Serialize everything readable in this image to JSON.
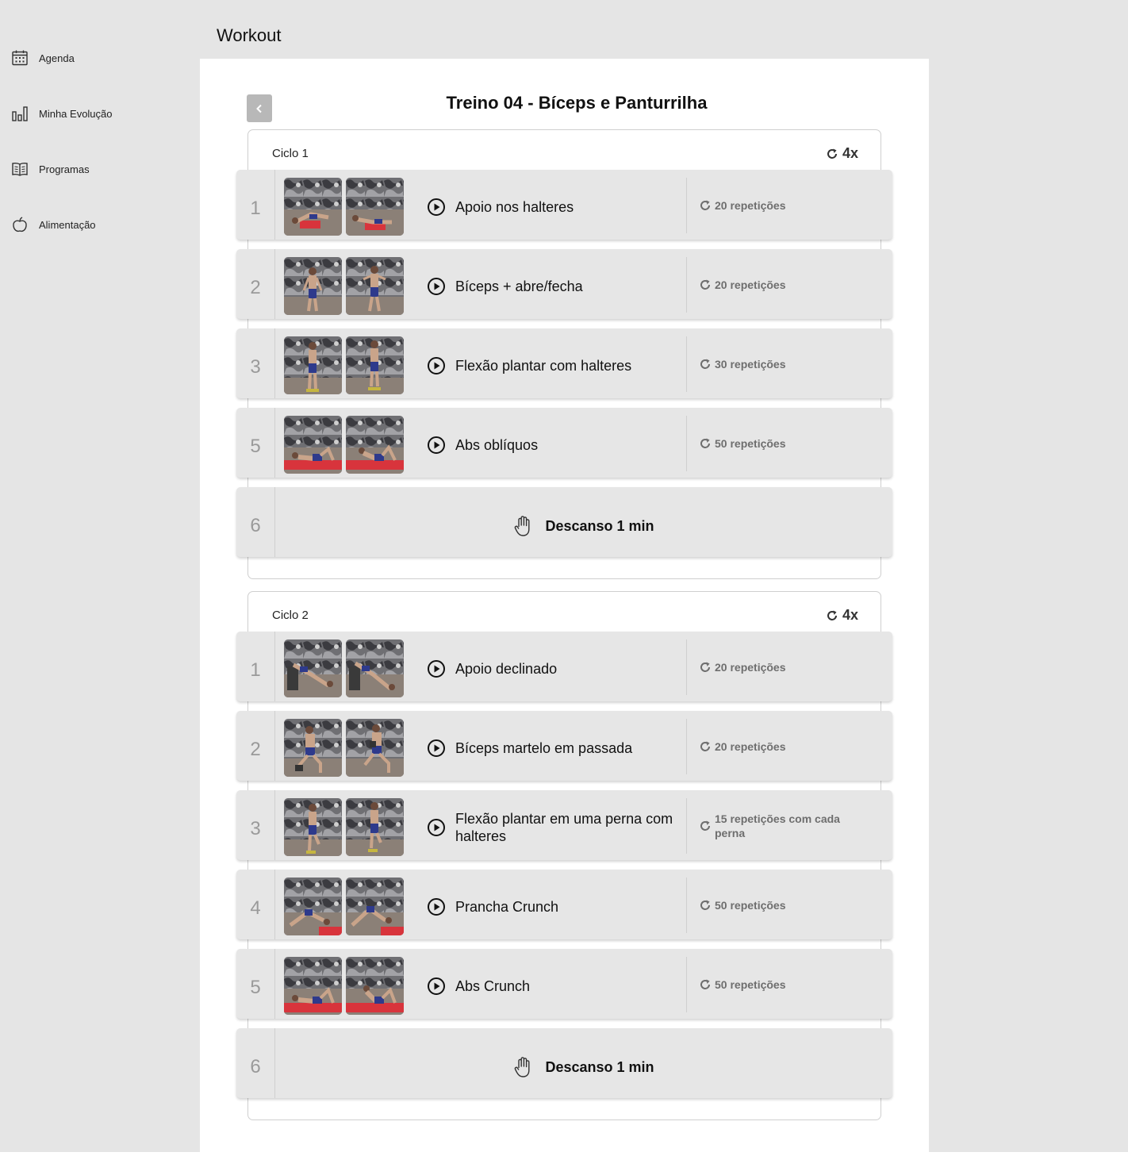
{
  "page": {
    "title": "Workout"
  },
  "sidebar": {
    "items": [
      {
        "label": "Agenda",
        "icon": "calendar-icon"
      },
      {
        "label": "Minha Evolução",
        "icon": "bar-chart-icon"
      },
      {
        "label": "Programas",
        "icon": "book-icon"
      },
      {
        "label": "Alimentação",
        "icon": "apple-icon"
      }
    ]
  },
  "workout": {
    "title": "Treino 04 - Bíceps e Panturrilha",
    "cycles": [
      {
        "name": "Ciclo 1",
        "repeat": "4x",
        "rows": [
          {
            "num": "1",
            "name": "Apoio nos halteres",
            "reps": "20 repetições"
          },
          {
            "num": "2",
            "name": "Bíceps + abre/fecha",
            "reps": "20 repetições"
          },
          {
            "num": "3",
            "name": "Flexão plantar com halteres",
            "reps": "30 repetições"
          },
          {
            "num": "5",
            "name": "Abs oblíquos",
            "reps": "50 repetições"
          },
          {
            "num": "6",
            "rest": "Descanso 1 min"
          }
        ]
      },
      {
        "name": "Ciclo 2",
        "repeat": "4x",
        "rows": [
          {
            "num": "1",
            "name": "Apoio declinado",
            "reps": "20 repetições"
          },
          {
            "num": "2",
            "name": "Bíceps martelo em passada",
            "reps": "20 repetições"
          },
          {
            "num": "3",
            "name": "Flexão plantar em uma perna com halteres",
            "reps": "15 repetições com cada perna"
          },
          {
            "num": "4",
            "name": "Prancha Crunch",
            "reps": "50 repetições"
          },
          {
            "num": "5",
            "name": "Abs Crunch",
            "reps": "50 repetições"
          },
          {
            "num": "6",
            "rest": "Descanso 1 min"
          }
        ]
      }
    ]
  },
  "colors": {
    "background": "#e5e5e5",
    "panel": "#ffffff",
    "row": "#e6e6e6",
    "number": "#9a9a9a",
    "reps": "#6e6e6e"
  }
}
